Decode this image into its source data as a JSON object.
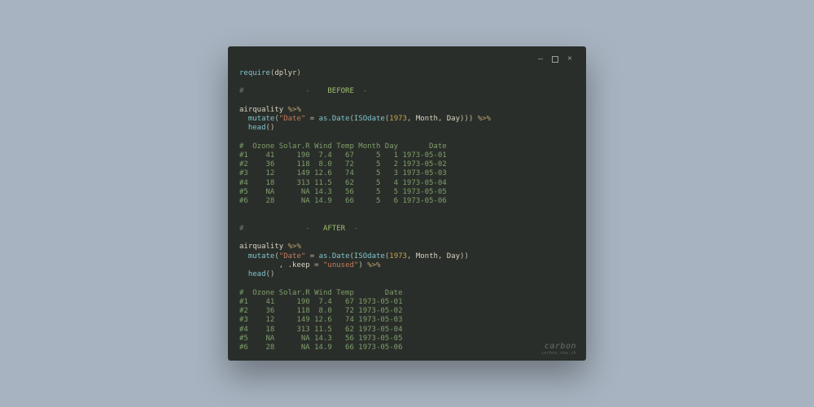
{
  "window": {
    "minimize_title": "Minimize",
    "maximize_title": "Maximize",
    "close_title": "Close"
  },
  "code": {
    "require_fn": "require",
    "dplyr": "dplyr",
    "before_label": "BEFORE",
    "after_label": "AFTER",
    "airquality": "airquality",
    "pipe": "%>%",
    "mutate": "mutate",
    "date_str": "\"Date\"",
    "eq": " = ",
    "asDate": "as.Date",
    "ISOdate": "ISOdate",
    "year": "1973",
    "month": "Month",
    "day": "Day",
    "head": "head",
    "keep_arg": ".keep",
    "unused_str": "\"unused\""
  },
  "output_before": {
    "header": "#  Ozone Solar.R Wind Temp Month Day       Date",
    "rows": [
      "#1    41     190  7.4   67     5   1 1973-05-01",
      "#2    36     118  8.0   72     5   2 1973-05-02",
      "#3    12     149 12.6   74     5   3 1973-05-03",
      "#4    18     313 11.5   62     5   4 1973-05-04",
      "#5    NA      NA 14.3   56     5   5 1973-05-05",
      "#6    28      NA 14.9   66     5   6 1973-05-06"
    ]
  },
  "output_after": {
    "header": "#  Ozone Solar.R Wind Temp       Date",
    "rows": [
      "#1    41     190  7.4   67 1973-05-01",
      "#2    36     118  8.0   72 1973-05-02",
      "#3    12     149 12.6   74 1973-05-03",
      "#4    18     313 11.5   62 1973-05-04",
      "#5    NA      NA 14.3   56 1973-05-05",
      "#6    28      NA 14.9   66 1973-05-06"
    ]
  },
  "watermark": {
    "brand": "carbon",
    "sub": "carbon.now.sh"
  }
}
